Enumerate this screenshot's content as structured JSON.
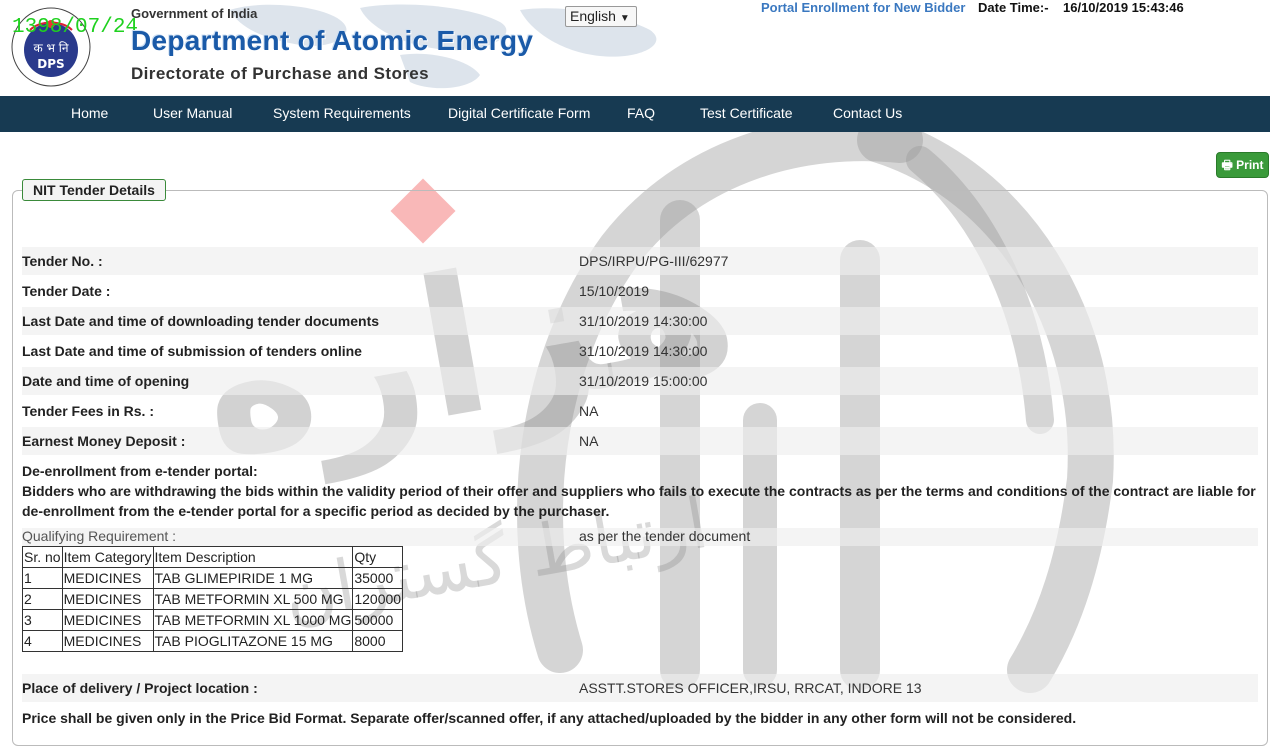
{
  "header": {
    "stamp": "1398/07/24",
    "emblem_text_top": "राष्ट्र की सेवा में परमाणु",
    "emblem_text_bottom": "ATOMS IN THE SERVICE OF THE NATION",
    "emblem_hindi": "क भ नि",
    "emblem_abbr": "DPS",
    "gov": "Government of India",
    "dept": "Department of Atomic Energy",
    "directorate": "Directorate of Purchase and Stores",
    "language": "English",
    "portal_link": "Portal Enrollment for New Bidder",
    "datetime_label": "Date Time:-",
    "datetime_value": "16/10/2019 15:43:46"
  },
  "nav": [
    "Home",
    "User Manual",
    "System Requirements",
    "Digital Certificate Form",
    "FAQ",
    "Test Certificate",
    "Contact Us"
  ],
  "print_label": "Print",
  "panel_title": "NIT Tender Details",
  "details": [
    {
      "label": "Tender No. :",
      "value": "DPS/IRPU/PG-III/62977"
    },
    {
      "label": "Tender Date :",
      "value": "15/10/2019"
    },
    {
      "label": "Last Date and time of downloading tender documents",
      "value": "31/10/2019 14:30:00"
    },
    {
      "label": "Last Date and time of submission of tenders online",
      "value": "31/10/2019 14:30:00"
    },
    {
      "label": "Date and time of opening",
      "value": "31/10/2019 15:00:00"
    },
    {
      "label": "Tender Fees in Rs. :",
      "value": "NA"
    },
    {
      "label": "Earnest Money Deposit :",
      "value": "NA"
    }
  ],
  "deenroll": {
    "title": "De-enrollment from e-tender portal:",
    "text": "Bidders who are withdrawing the bids within the validity period of their offer and suppliers who fails to execute the contracts as per the terms and conditions of the contract are liable for de-enrollment from the e-tender portal for a specific period as decided by the purchaser."
  },
  "qualifying": {
    "label": "Qualifying Requirement :",
    "value": "as per the tender document"
  },
  "items_table": {
    "headers": [
      "Sr. no",
      "Item Category",
      "Item Description",
      "Qty"
    ],
    "rows": [
      [
        "1",
        "MEDICINES",
        "TAB GLIMEPIRIDE 1 MG",
        "35000"
      ],
      [
        "2",
        "MEDICINES",
        "TAB METFORMIN XL 500 MG",
        "120000"
      ],
      [
        "3",
        "MEDICINES",
        "TAB METFORMIN XL 1000 MG",
        "50000"
      ],
      [
        "4",
        "MEDICINES",
        "TAB PIOGLITAZONE 15 MG",
        "8000"
      ]
    ]
  },
  "delivery": {
    "label": "Place of delivery / Project location :",
    "value": "ASSTT.STORES OFFICER,IRSU, RRCAT, INDORE 13"
  },
  "price_note": "Price shall be given only in the Price Bid Format. Separate offer/scanned offer, if any attached/uploaded by the bidder in any other form will not be considered.",
  "watermark": {
    "text_main": "هزاره",
    "text_sub": "ارتباط گستران"
  },
  "colors": {
    "nav_bg": "#173a52",
    "dept_blue": "#1a5aa8",
    "print_green": "#3a9a3a",
    "stamp_green": "#1fd11f"
  }
}
